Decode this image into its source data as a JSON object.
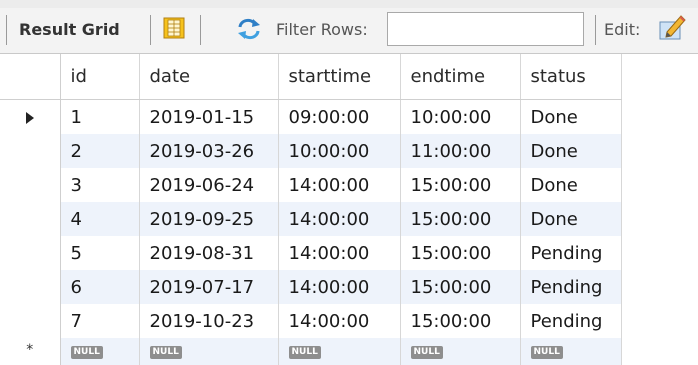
{
  "toolbar": {
    "result_grid_label": "Result Grid",
    "filter_rows_label": "Filter Rows:",
    "filter_value": "",
    "edit_label": "Edit:"
  },
  "icons": {
    "form_editor": "form-editor-icon",
    "refresh": "refresh-icon",
    "edit": "edit-pencil-icon"
  },
  "grid": {
    "columns": [
      "id",
      "date",
      "starttime",
      "endtime",
      "status"
    ],
    "rows": [
      [
        "1",
        "2019-01-15",
        "09:00:00",
        "10:00:00",
        "Done"
      ],
      [
        "2",
        "2019-03-26",
        "10:00:00",
        "11:00:00",
        "Done"
      ],
      [
        "3",
        "2019-06-24",
        "14:00:00",
        "15:00:00",
        "Done"
      ],
      [
        "4",
        "2019-09-25",
        "14:00:00",
        "15:00:00",
        "Done"
      ],
      [
        "5",
        "2019-08-31",
        "14:00:00",
        "15:00:00",
        "Pending"
      ],
      [
        "6",
        "2019-07-17",
        "14:00:00",
        "15:00:00",
        "Pending"
      ],
      [
        "7",
        "2019-10-23",
        "14:00:00",
        "15:00:00",
        "Pending"
      ]
    ],
    "null_label": "NULL",
    "current_row_marker": "▶",
    "new_row_marker": "*"
  },
  "colors": {
    "alt_row": "#eef3fb",
    "null_badge": "#8e8e8e",
    "refresh_arrow": "#2f7fc6"
  }
}
